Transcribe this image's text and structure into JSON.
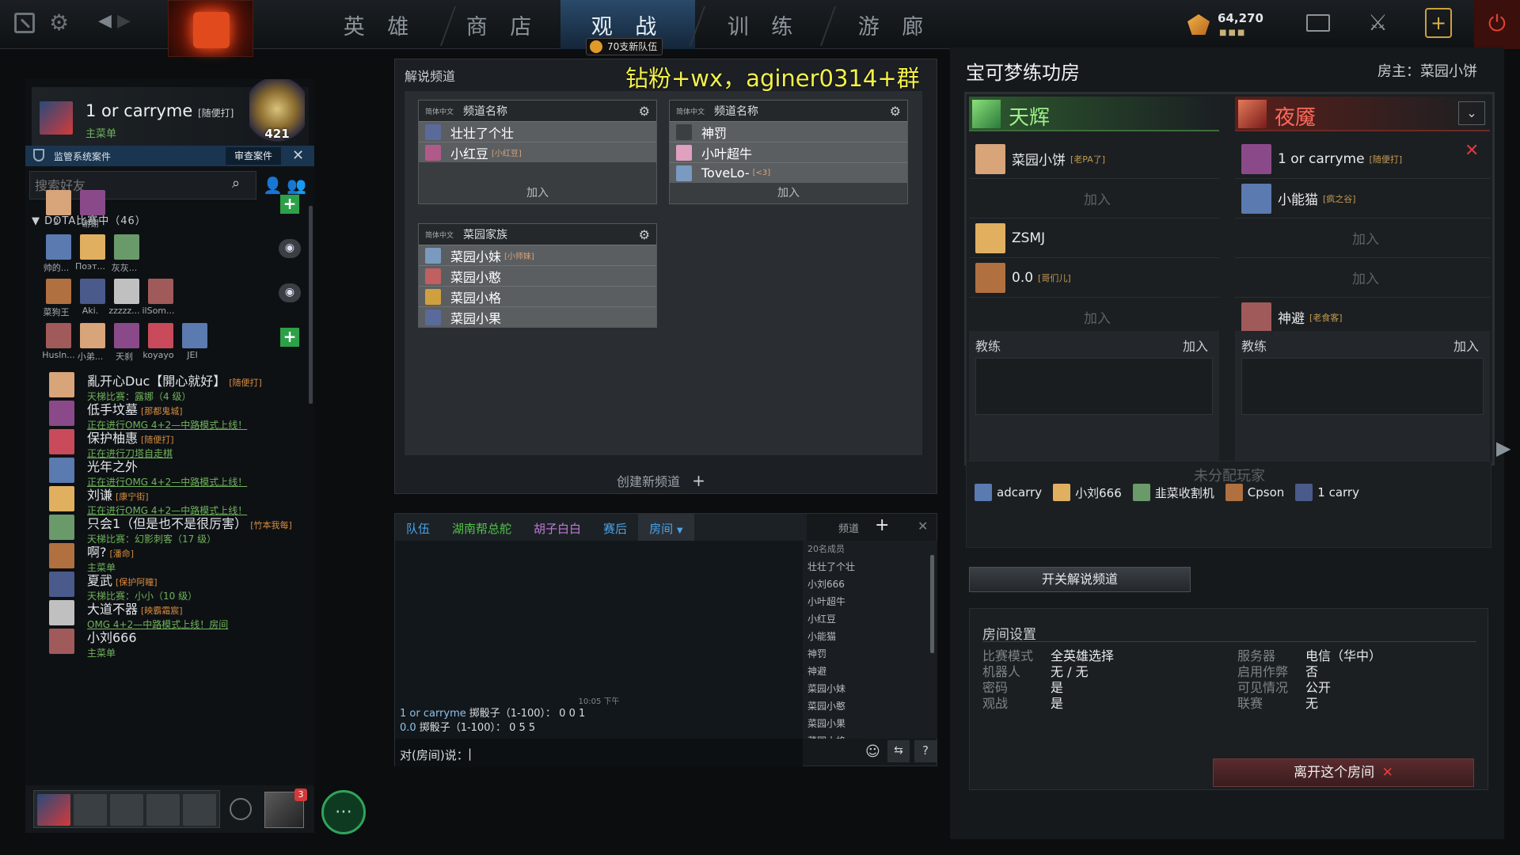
{
  "topnav": {
    "tabs": [
      "英 雄",
      "商 店",
      "观 战",
      "训 练",
      "游 廊"
    ],
    "spectate_badge": "70支新队伍",
    "currency": "64,270"
  },
  "overlay_text": "钻粉+wx，aginer0314+群",
  "profile": {
    "name": "1 or carryme",
    "tag": "[随便打]",
    "sub": "主菜单",
    "rank_number": "421"
  },
  "overwatch": {
    "label": "监管系统案件",
    "button": "审查案件"
  },
  "friends": {
    "search_placeholder": "搜索好友",
    "group_header": "DOTA比赛中（46）",
    "groups": [
      [
        "2",
        "谢谢"
      ],
      [
        "帅的...",
        "Поэт...",
        "灰灰..."
      ],
      [
        "菜狗王",
        "Aki.",
        "zzzzz...",
        "ilSom..."
      ],
      [
        "Husln...",
        "小弟...",
        "天刹",
        "koyayo",
        "JEI"
      ]
    ],
    "list": [
      {
        "name": "亂开心Duc【開心就好】",
        "tag": "[随便打]",
        "status": "天梯比赛：露娜（4 级）",
        "link": false
      },
      {
        "name": "低手坟墓",
        "tag": "[那都鬼城]",
        "status": "正在进行OMG 4+2—中路模式上线！",
        "link": true
      },
      {
        "name": "保护柚惠",
        "tag": "[随便打]",
        "status": "正在进行刀塔自走棋",
        "link": true
      },
      {
        "name": "光年之外",
        "tag": "",
        "status": "正在进行OMG 4+2—中路模式上线！",
        "link": true
      },
      {
        "name": "刘谦",
        "tag": "[康宁街]",
        "status": "正在进行OMG 4+2—中路模式上线！",
        "link": true
      },
      {
        "name": "只会1（但是也不是很厉害）",
        "tag": "[竹本我每]",
        "status": "天梯比赛：幻影刺客（17 级）",
        "link": false
      },
      {
        "name": "啊?",
        "tag": "[潘命]",
        "status": "主菜单",
        "link": false
      },
      {
        "name": "夏武",
        "tag": "[保护阿瞳]",
        "status": "天梯比赛：小小（10 级）",
        "link": false
      },
      {
        "name": "大道不器",
        "tag": "[映霸霜宸]",
        "status": "OMG 4+2—中路模式上线！房间",
        "link": true
      },
      {
        "name": "小刘666",
        "tag": "",
        "status": "主菜单",
        "link": false
      }
    ]
  },
  "party": {
    "notify_count": "3"
  },
  "channels": {
    "title": "解说频道",
    "create": "创建新频道",
    "boxes": [
      {
        "lang": "简体中文",
        "name": "频道名称",
        "members": [
          "壮壮了个壮",
          "小红豆"
        ],
        "tags": [
          "",
          "[小红豆]"
        ],
        "join": "加入"
      },
      {
        "lang": "简体中文",
        "name": "频道名称",
        "members": [
          "神罚",
          "小叶超牛",
          "ToveLo-"
        ],
        "tags": [
          "",
          "",
          "[<3]"
        ],
        "join": "加入"
      },
      {
        "lang": "简体中文",
        "name": "菜园家族",
        "members": [
          "菜园小妹",
          "菜园小憨",
          "菜园小格",
          "菜园小果"
        ],
        "tags": [
          "[小师妹]",
          "",
          "",
          ""
        ],
        "join": ""
      }
    ]
  },
  "chat": {
    "tabs": [
      "队伍",
      "湖南帮总舵",
      "胡子白白",
      "赛后",
      "房间"
    ],
    "channel_label": "频道",
    "timestamp": "10:05 下午",
    "messages": [
      {
        "who": "1 or carryme",
        "text": "掷骰子（1-100）： 0 0 1"
      },
      {
        "who": "0.0",
        "text": "掷骰子（1-100）： 0 5 5"
      }
    ],
    "input_prefix": "对(房间)说：",
    "member_count": "20名成员",
    "members": [
      "壮壮了个壮",
      "小刘666",
      "小叶超牛",
      "小红豆",
      "小能猫",
      "神罚",
      "神避",
      "菜园小妹",
      "菜园小憨",
      "菜园小果",
      "菜园小格"
    ]
  },
  "lobby": {
    "title": "宝可梦练功房",
    "host": "房主：菜园小饼",
    "radiant": {
      "name": "天辉",
      "slots": [
        {
          "name": "菜园小饼",
          "tag": "[老PA了]"
        },
        {
          "name": "加入",
          "tag": ""
        },
        {
          "name": "ZSMJ",
          "tag": ""
        },
        {
          "name": "0.0",
          "tag": "[哥们儿]"
        },
        {
          "name": "加入",
          "tag": ""
        }
      ]
    },
    "dire": {
      "name": "夜魇",
      "slots": [
        {
          "name": "1 or carryme",
          "tag": "[随便打]"
        },
        {
          "name": "小能猫",
          "tag": "[疯之谷]"
        },
        {
          "name": "加入",
          "tag": ""
        },
        {
          "name": "加入",
          "tag": ""
        },
        {
          "name": "神避",
          "tag": "[老食客]"
        }
      ]
    },
    "coach_label": "教练",
    "coach_join": "加入",
    "unassigned_title": "未分配玩家",
    "unassigned": [
      "adcarry",
      "小刘666",
      "韭菜收割机",
      "Cpson",
      "1 carry"
    ],
    "toggle_broadcast": "开关解说频道",
    "settings_title": "房间设置",
    "settings_left": [
      [
        "比赛模式",
        "全英雄选择"
      ],
      [
        "机器人",
        "无 / 无"
      ],
      [
        "密码",
        "是"
      ],
      [
        "观战",
        "是"
      ]
    ],
    "settings_right": [
      [
        "服务器",
        "电信（华中）"
      ],
      [
        "启用作弊",
        "否"
      ],
      [
        "可见情况",
        "公开"
      ],
      [
        "联赛",
        "无"
      ]
    ],
    "leave": "离开这个房间"
  },
  "colors": {
    "radiant": "#7cd15e",
    "dire": "#e25a4a",
    "link": "#6fb35b",
    "accent": "#3f78b0"
  }
}
